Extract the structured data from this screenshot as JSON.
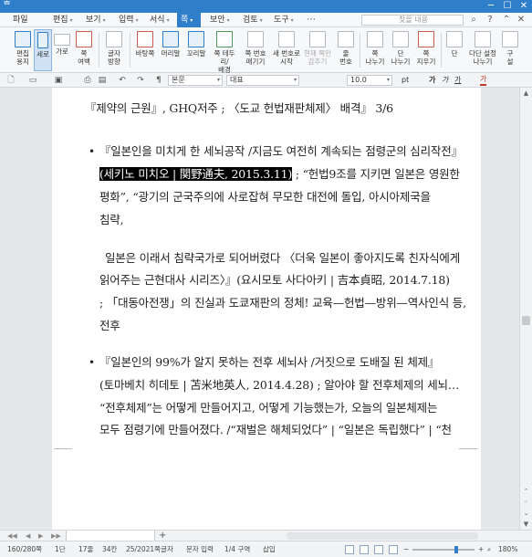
{
  "window": {
    "title": "",
    "minimize": "─",
    "maximize": "☐",
    "close": "✕"
  },
  "menu": {
    "file": "파일",
    "items": [
      "편집",
      "보기",
      "입력",
      "서식",
      "쪽",
      "보안",
      "검토",
      "도구"
    ],
    "active_index": 4,
    "find_placeholder": "찾을 내용"
  },
  "ribbon": [
    {
      "label": "편집\n용지"
    },
    {
      "label": "세로"
    },
    {
      "label": "가로"
    },
    {
      "label": "쪽\n여백"
    },
    {
      "label": "글자\n방향"
    },
    {
      "label": "바탕쪽"
    },
    {
      "label": "머리말"
    },
    {
      "label": "꼬리말"
    },
    {
      "label": "쪽 테두리/\n배경"
    },
    {
      "label": "쪽 번호\n매기기"
    },
    {
      "label": "새 번호로\n시작"
    },
    {
      "label": "현재 쪽만\n감추기"
    },
    {
      "label": "줄\n번호"
    },
    {
      "label": "쪽\n나누기"
    },
    {
      "label": "단\n나누기"
    },
    {
      "label": "쪽\n지우기"
    },
    {
      "label": "단"
    },
    {
      "label": "다단 설정\n나누기"
    },
    {
      "label": "구\n설"
    }
  ],
  "ribbon_selected": 1,
  "format": {
    "style": "본문",
    "font": "대표",
    "size": "10.0",
    "unit": "pt",
    "bold": "가",
    "italic": "가",
    "underline": "가",
    "fontcolor": "가"
  },
  "doc": {
    "line0": "『제약의 근원』, GHQ저주 ; 〈도교 헌법재판체제〉 배격』 3/6",
    "p1": [
      "『일본인을 미치게 한 세뇌공작 /지금도 여전히 계속되는 점령군의 심리작전』",
      "(세키노 미치오 | 関野通夫, 2015.3.11)",
      " ; “헌법9조를 지키면 일본은 영원한",
      "평화”, “광기의 군국주의에 사로잡혀 무모한 대전에 돌입, 아시아제국을",
      "침략,"
    ],
    "p2": [
      "일본은 이래서 침략국가로 되어버렸다 〈더욱 일본이 좋아지도록 친자식에게",
      "읽어주는 근현대사 시리즈〉』(요시모토 사다아키 | 吉本貞昭, 2014.7.18)",
      "; 「대동아전쟁」의 진실과 도쿄재판의 정체! 교육—헌법—방위—역사인식 등,",
      "전후"
    ],
    "p3": [
      "『일본인의 99%가 알지 못하는 전후 세뇌사 /거짓으로 도배질 된 체제』",
      "(토마베치 히데토 | 苫米地英人, 2014.4.28) ; 알아야 할 전후체제의 세뇌…",
      "“전후체제”는 어떻게 만들어지고, 어떻게 기능했는가, 오늘의 일본체제는",
      "모두 점령기에 만들어졌다. /“재벌은 해체되었다” | “일본은 독립했다” | “천"
    ]
  },
  "status": {
    "page": "160/280쪽",
    "section": "1단",
    "line": "17줄",
    "col": "34칸",
    "chars": "25/2021쪽글자",
    "mode": "문자 입력",
    "sect": "1/4 구역",
    "insert": "삽입",
    "zoom": "180%",
    "zoom_level": 0.72
  }
}
